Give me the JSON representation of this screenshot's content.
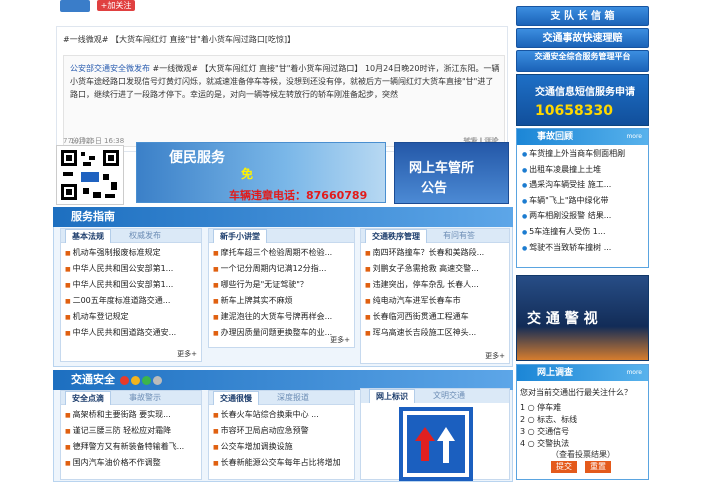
{
  "top": {
    "follow_label": "+加关注"
  },
  "weibo": {
    "line1": "#一线微观# 【大货车闯红灯 直接\"甘\"着小货车闯过路口[吃惊]】",
    "author": "公安部交通安全微发布",
    "post": "#一线微观# 【大货车闯红灯 直接\"甘\"着小货车闯过路口】 10月24日晚20时许，浙江东阳。一辆小货车途经路口发现信号灯黄灯闪烁，就减速准备停车等候，没想到还没有停，就被后方一辆闯红灯大货车直接\"甘\"进了路口，继续行进了一段路才停下。幸运的是，对向一辆等候左转放行的轿车刚准备起步，突然",
    "time": "10月25日 16:38",
    "ops": "转发 | 评论",
    "count": "77分钟前",
    "ops2": "转发 | 评论"
  },
  "banner1": {
    "title": "便民服务",
    "free": "免",
    "phone": "车辆违章电话：87660789"
  },
  "banner2": {
    "line1": "网上车管所",
    "line2": "公告"
  },
  "guide": {
    "title": "服务指南",
    "col1": {
      "tab_a": "基本法规",
      "tab_b": "权威发布",
      "items": [
        "机动车强制报废标准规定",
        "中华人民共和国公安部第1...",
        "中华人民共和国公安部第1...",
        "二00五年度标准道路交通...",
        "机动车登记规定",
        "中华人民共和国道路交通安..."
      ],
      "more": "更多+"
    },
    "col2": {
      "tab_a": "新手小讲堂",
      "tab_b": "",
      "items": [
        "摩托车超三个检验周期不检验...",
        "一个记分周期内记满12分指...",
        "哪些行为是\"无证驾驶\"？",
        "新车上牌其实不麻烦",
        "建泥泡往的大货车号牌再样会...",
        "办理因质量问题更换整车的业..."
      ],
      "more": "更多+"
    },
    "col3": {
      "tab_a": "交通秩序管理",
      "tab_b": "有问有答",
      "items": [
        "南四环路撞车？长春和美路段...",
        "刘鹏女子急需抢救 高速交警...",
        "违建突出，停车杂乱 长春人...",
        "纯电动汽车进军长春车市",
        "长春临河西街贯通工程通车",
        "珲乌高速长吉段施工区神头..."
      ],
      "more": "更多+"
    }
  },
  "safety": {
    "title": "交通安全",
    "col1": {
      "tab_a": "安全点滴",
      "tab_b": "事故警示",
      "items": [
        "高架桥和主要街路 要实现...",
        "谨记三腰三防 轻松应对霜降",
        "德拜警方又有新装备特输着飞...",
        "国内汽车油价格不作调整"
      ]
    },
    "col2": {
      "tab_a": "交通很慢",
      "tab_b": "深度报道",
      "items": [
        "长春火车站综合换乘中心 ...",
        "市容环卫局启动应急预警",
        "公交车增加调换设施",
        "长春新能源公交车每年占比将增加"
      ]
    },
    "col3": {
      "tab_a": "网上标识",
      "tab_b": "文明交通"
    }
  },
  "right": {
    "btn1": "支 队 长 信 箱",
    "btn2": "交通事故快速理赔",
    "btn3": "交通安全综合服务管理平台",
    "sms_line1": "交通信息短信服务申请",
    "sms_number": "10658330",
    "accident": {
      "title": "事故回顾",
      "more": "more",
      "items": [
        "车货撞上外当商车侧面相剐",
        "出租车凌晨撞上土堆",
        "遇采沟车辆受挂 施工...",
        "车辆\"飞上\"路中绿化带",
        "两车相剐没报警 结果...",
        "5车连撞有人受伤 1...",
        "驾驶不当致轿车撞树 ..."
      ]
    },
    "video_title": "交 通 警 视",
    "poll": {
      "title": "网上调查",
      "more": "more",
      "question": "您对当前交通出行最关注什么？",
      "options": [
        "停车难",
        "标志、标线",
        "交通信号",
        "交警执法"
      ],
      "result": "（查看投票结果）",
      "vote": "提交",
      "reset": "重置"
    }
  },
  "colors": {
    "accent": "#1d6fc0",
    "new": "#e02020",
    "sms_number": "#ffd800"
  }
}
